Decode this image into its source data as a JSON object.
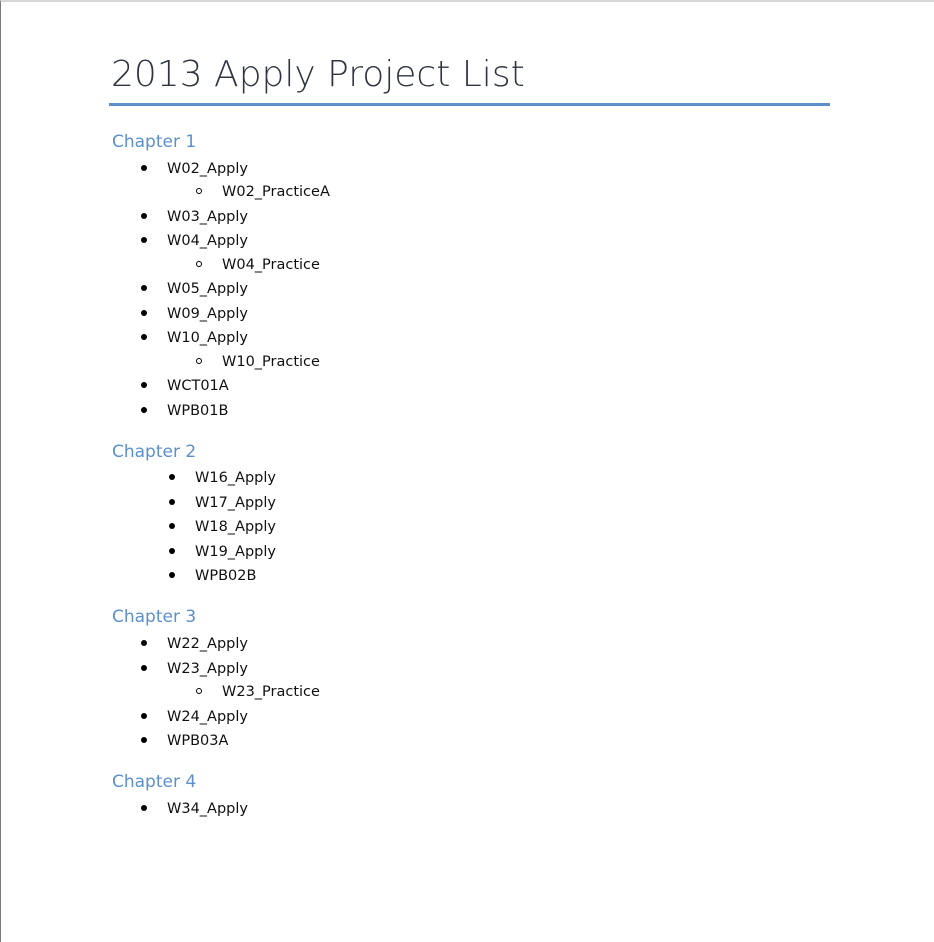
{
  "document": {
    "title": "2013 Apply Project List",
    "chapters": [
      {
        "heading": "Chapter 1",
        "items": [
          {
            "label": "W02_Apply",
            "subitems": [
              "W02_PracticeA"
            ]
          },
          {
            "label": "W03_Apply",
            "subitems": []
          },
          {
            "label": "W04_Apply",
            "subitems": [
              "W04_Practice"
            ]
          },
          {
            "label": "W05_Apply",
            "subitems": []
          },
          {
            "label": "W09_Apply",
            "subitems": []
          },
          {
            "label": "W10_Apply",
            "subitems": [
              "W10_Practice"
            ]
          },
          {
            "label": "WCT01A",
            "subitems": []
          },
          {
            "label": "WPB01B",
            "subitems": []
          }
        ]
      },
      {
        "heading": "Chapter 2",
        "items": [
          {
            "label": "W16_Apply",
            "subitems": []
          },
          {
            "label": "W17_Apply",
            "subitems": []
          },
          {
            "label": "W18_Apply",
            "subitems": []
          },
          {
            "label": "W19_Apply",
            "subitems": []
          },
          {
            "label": "WPB02B",
            "subitems": []
          }
        ]
      },
      {
        "heading": "Chapter 3",
        "items": [
          {
            "label": "W22_Apply",
            "subitems": []
          },
          {
            "label": "W23_Apply",
            "subitems": [
              "W23_Practice"
            ]
          },
          {
            "label": "W24_Apply",
            "subitems": []
          },
          {
            "label": "WPB03A",
            "subitems": []
          }
        ]
      },
      {
        "heading": "Chapter 4",
        "items": [
          {
            "label": "W34_Apply",
            "subitems": []
          }
        ]
      }
    ]
  }
}
